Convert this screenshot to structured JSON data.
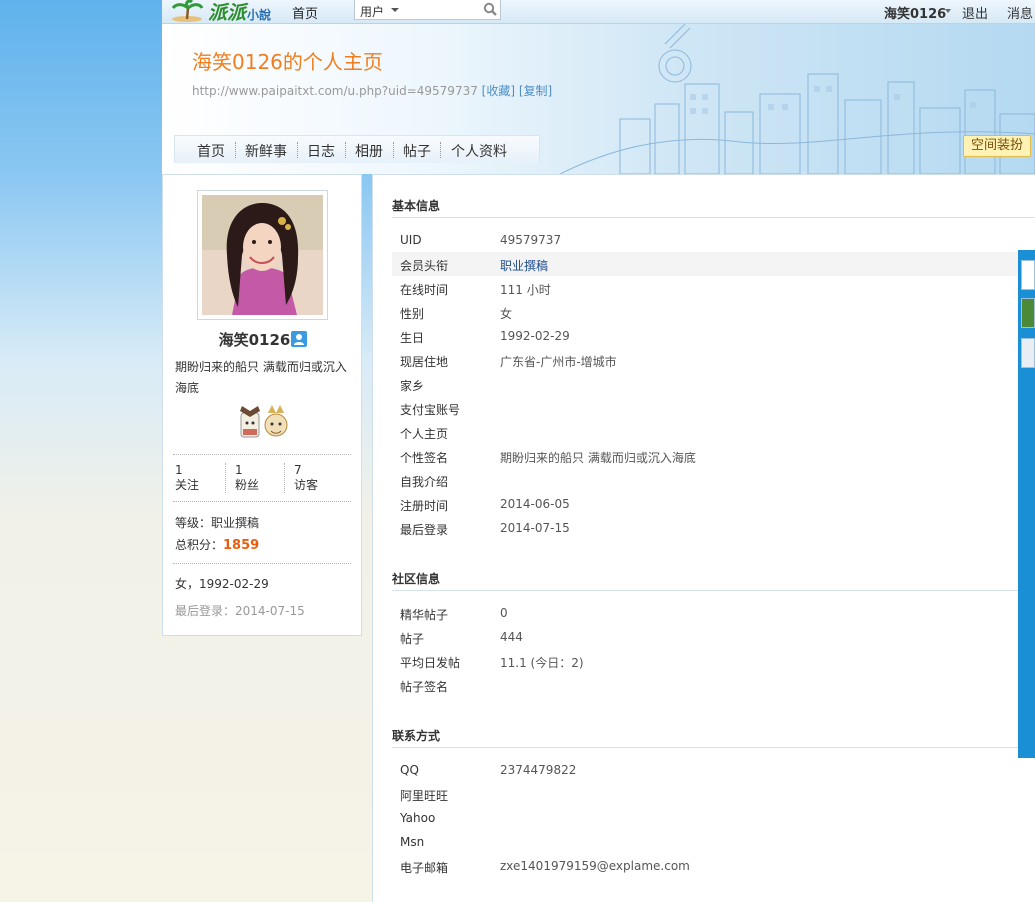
{
  "topbar": {
    "logo_text": "派派",
    "logo_suffix": "小說",
    "home": "首页",
    "search_category": "用户",
    "username": "海笑0126",
    "logout": "退出",
    "messages": "消息"
  },
  "header": {
    "title": "海笑0126的个人主页",
    "url": "http://www.paipaitxt.com/u.php?uid=49579737",
    "bookmark": "[收藏]",
    "copy": "[复制]",
    "decorate_button": "空间装扮"
  },
  "nav": {
    "items": [
      "首页",
      "新鲜事",
      "日志",
      "相册",
      "帖子",
      "个人资料"
    ]
  },
  "profile_card": {
    "name": "海笑0126",
    "signature": "期盼归来的船只 满载而归或沉入海底",
    "stats": [
      {
        "count": "1",
        "label": "关注"
      },
      {
        "count": "1",
        "label": "粉丝"
      },
      {
        "count": "7",
        "label": "访客"
      }
    ],
    "level_label": "等级：",
    "level_value": "职业撰稿",
    "points_label": "总积分：",
    "points_value": "1859",
    "gender_birthday": "女，1992-02-29",
    "last_login_label": "最后登录：",
    "last_login_value": "2014-07-15"
  },
  "basic_info": {
    "title": "基本信息",
    "rows": [
      {
        "k": "UID",
        "v": "49579737"
      },
      {
        "k": "会员头衔",
        "v": "职业撰稿"
      },
      {
        "k": "在线时间",
        "v": "111 小时"
      },
      {
        "k": "性别",
        "v": "女"
      },
      {
        "k": "生日",
        "v": "1992-02-29"
      },
      {
        "k": "现居住地",
        "v": "广东省-广州市-增城市"
      },
      {
        "k": "家乡",
        "v": ""
      },
      {
        "k": "支付宝账号",
        "v": ""
      },
      {
        "k": "个人主页",
        "v": ""
      },
      {
        "k": "个性签名",
        "v": "期盼归来的船只 满载而归或沉入海底"
      },
      {
        "k": "自我介绍",
        "v": ""
      },
      {
        "k": "注册时间",
        "v": "2014-06-05"
      },
      {
        "k": "最后登录",
        "v": "2014-07-15"
      }
    ]
  },
  "community_info": {
    "title": "社区信息",
    "rows": [
      {
        "k": "精华帖子",
        "v": "0"
      },
      {
        "k": "帖子",
        "v": "444"
      },
      {
        "k": "平均日发帖",
        "v": "11.1 (今日：2)"
      },
      {
        "k": "帖子签名",
        "v": ""
      }
    ]
  },
  "contact_info": {
    "title": "联系方式",
    "rows": [
      {
        "k": "QQ",
        "v": "2374479822"
      },
      {
        "k": "阿里旺旺",
        "v": ""
      },
      {
        "k": "Yahoo",
        "v": ""
      },
      {
        "k": "Msn",
        "v": ""
      },
      {
        "k": "电子邮箱",
        "v": "zxe1401979159@explame.com"
      }
    ]
  },
  "colors": {
    "accent_orange": "#f07d1e",
    "link_blue": "#1d4b8a",
    "points_red": "#e85d10",
    "side_tab_blue": "#1a8fd5"
  }
}
